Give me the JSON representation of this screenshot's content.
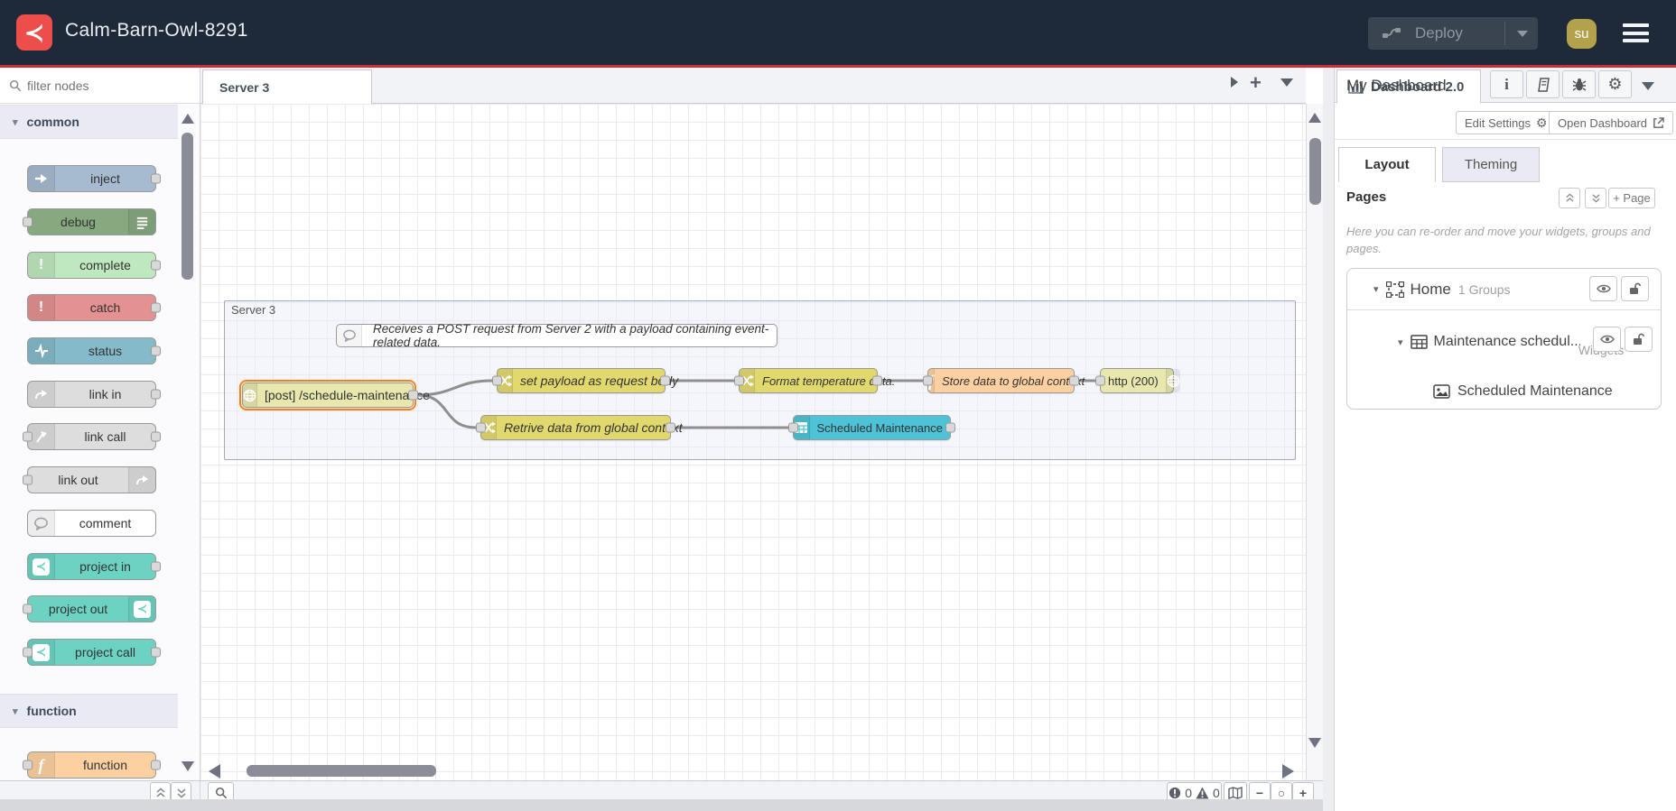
{
  "header": {
    "title": "Calm-Barn-Owl-8291",
    "deploy_label": "Deploy",
    "avatar_text": "su"
  },
  "palette": {
    "filter_placeholder": "filter nodes",
    "category_common": "common",
    "category_function": "function",
    "items": [
      {
        "label": "inject"
      },
      {
        "label": "debug"
      },
      {
        "label": "complete"
      },
      {
        "label": "catch"
      },
      {
        "label": "status"
      },
      {
        "label": "link in"
      },
      {
        "label": "link call"
      },
      {
        "label": "link out"
      },
      {
        "label": "comment"
      },
      {
        "label": "project in"
      },
      {
        "label": "project out"
      },
      {
        "label": "project call"
      },
      {
        "label": "function"
      }
    ]
  },
  "workspace": {
    "tab_label": "Server 3",
    "group_label": "Server 3",
    "comment_text": "Receives a POST request from Server 2 with a payload containing event-related data.",
    "nodes": [
      {
        "label": "[post] /schedule-maintenance"
      },
      {
        "label": "set payload as request body"
      },
      {
        "label": "Format temperature data."
      },
      {
        "label": "Store data to global context"
      },
      {
        "label": "http (200)"
      },
      {
        "label": "Retrive data from global context"
      },
      {
        "label": "Scheduled Maintenance"
      }
    ],
    "status": {
      "errors": "0",
      "warnings": "0"
    },
    "zoom_out": "−",
    "zoom_reset": "○",
    "zoom_in": "+"
  },
  "sidebar": {
    "tab_label": "Dashboard 2.0",
    "dashboard_name": "My Dashboard",
    "edit_settings_label": "Edit Settings",
    "open_dashboard_label": "Open Dashboard",
    "tab_layout": "Layout",
    "tab_theming": "Theming",
    "pages_label": "Pages",
    "add_page_label": "+ Page",
    "help_text": "Here you can re-order and move your widgets, groups and pages.",
    "tree": {
      "page_label": "Home",
      "page_meta": "1 Groups",
      "group_label": "Maintenance schedul...",
      "group_meta": "1 Widgets",
      "widget_label": "Scheduled Maintenance"
    }
  },
  "colors": {
    "accent_red": "#cb2e34",
    "node_http": "#e7e7ae",
    "node_change": "#e2d96e",
    "node_function": "#fdd0a2",
    "node_table": "#4ec2d6",
    "selection": "#ff7f0e"
  }
}
